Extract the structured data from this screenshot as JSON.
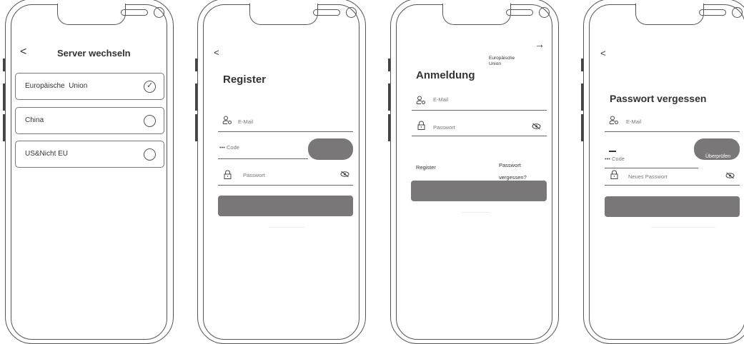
{
  "screen1": {
    "back": "<",
    "title": "Server wechseln",
    "options": [
      {
        "label": "Europäische  Union",
        "selected": true
      },
      {
        "label": "China",
        "selected": false
      },
      {
        "label": "US&Nicht EU",
        "selected": false
      }
    ]
  },
  "screen2": {
    "back": "<",
    "title": "Register",
    "email_placeholder": "E-Mail",
    "code_placeholder": "Code",
    "password_placeholder": "Passwort"
  },
  "screen3": {
    "forward": "→",
    "region_line1": "Europäische",
    "region_line2": "Union",
    "title": "Anmeldung",
    "email_placeholder": "E-Mail",
    "password_placeholder": "Passwort",
    "register": "Register",
    "forgot_line1": "Passwort",
    "forgot_line2": "vergessen?"
  },
  "screen4": {
    "back": "<",
    "title": "Passwort vergessen",
    "email_placeholder": "E-Mail",
    "code_placeholder": "Code",
    "verify_button": "Überprüfen",
    "new_password_placeholder": "Neues Passwort"
  },
  "icons": [
    "user-gear-icon",
    "lock-icon",
    "eye-off-icon",
    "check-icon",
    "dots-icon"
  ]
}
